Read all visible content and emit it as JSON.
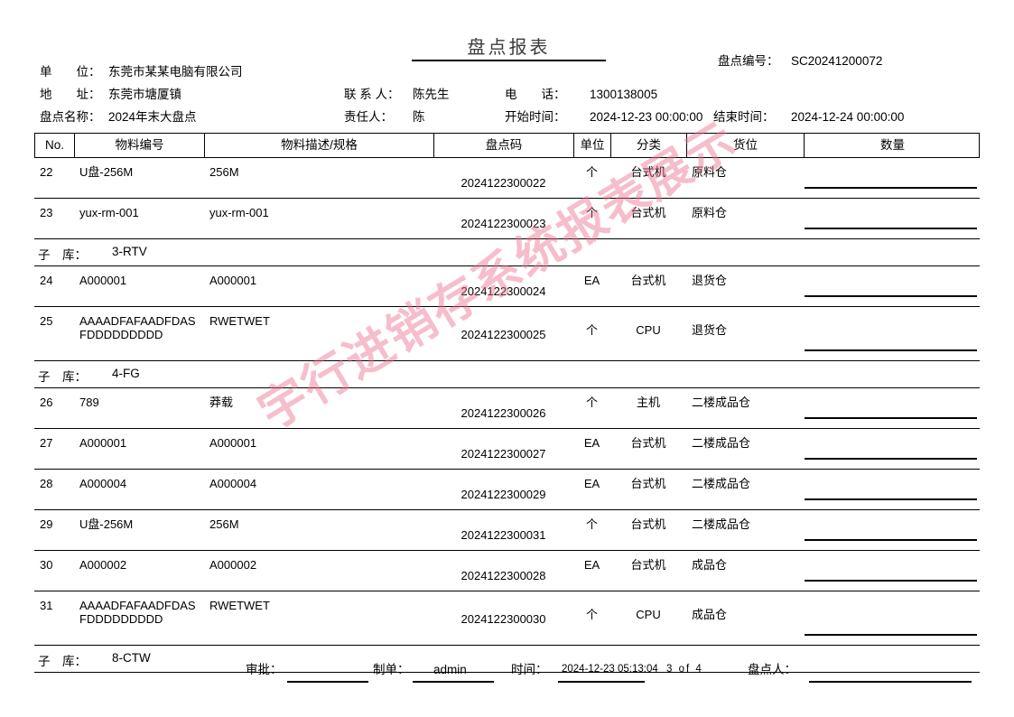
{
  "document": {
    "title": "盘点报表",
    "watermark": "宇行进销存系统报表展示"
  },
  "header": {
    "company_label": "单　　位：",
    "company_value": "东莞市某某电脑有限公司",
    "address_label": "地　　址：",
    "address_value": "东莞市塘厦镇",
    "plan_name_label": "盘点名称：",
    "plan_name_value": "2024年末大盘点",
    "contact_label": "联 系 人：",
    "contact_value": "陈先生",
    "owner_label": "责任人：",
    "owner_value": "陈",
    "phone_label": "电　　话：",
    "phone_value": "1300138005",
    "start_label": "开始时间：",
    "start_value": "2024-12-23 00:00:00",
    "end_label": "结束时间：",
    "end_value": "2024-12-24 00:00:00",
    "doc_no_label": "盘点编号：",
    "doc_no_value": "SC20241200072"
  },
  "table": {
    "columns": [
      {
        "key": "no",
        "label": "No."
      },
      {
        "key": "code",
        "label": "物料编号"
      },
      {
        "key": "desc",
        "label": "物料描述/规格"
      },
      {
        "key": "barcode",
        "label": "盘点码"
      },
      {
        "key": "unit",
        "label": "单位"
      },
      {
        "key": "category",
        "label": "分类"
      },
      {
        "key": "location",
        "label": "货位"
      },
      {
        "key": "qty",
        "label": "数量"
      }
    ],
    "rows": [
      {
        "type": "item",
        "no": "22",
        "code": "U盘-256M",
        "desc": "256M",
        "barcode": "2024122300022",
        "unit": "个",
        "category": "台式机",
        "location": "原料仓",
        "qty": ""
      },
      {
        "type": "item",
        "no": "23",
        "code": "yux-rm-001",
        "desc": "yux-rm-001",
        "barcode": "2024122300023",
        "unit": "个",
        "category": "台式机",
        "location": "原料仓",
        "qty": ""
      },
      {
        "type": "group",
        "label": "子　库：",
        "value": "3-RTV"
      },
      {
        "type": "item",
        "no": "24",
        "code": "A000001",
        "desc": "A000001",
        "barcode": "2024122300024",
        "unit": "EA",
        "category": "台式机",
        "location": "退货仓",
        "qty": ""
      },
      {
        "type": "item",
        "no": "25",
        "code": "AAAADFAFAADFDAS\nFDDDDDDDDD",
        "desc": "RWETWET",
        "barcode": "2024122300025",
        "unit": "个",
        "category": "CPU",
        "location": "退货仓",
        "qty": ""
      },
      {
        "type": "group",
        "label": "子　库：",
        "value": "4-FG"
      },
      {
        "type": "item",
        "no": "26",
        "code": "789",
        "desc": "莽载",
        "barcode": "2024122300026",
        "unit": "个",
        "category": "主机",
        "location": "二楼成品仓",
        "qty": ""
      },
      {
        "type": "item",
        "no": "27",
        "code": "A000001",
        "desc": "A000001",
        "barcode": "2024122300027",
        "unit": "EA",
        "category": "台式机",
        "location": "二楼成品仓",
        "qty": ""
      },
      {
        "type": "item",
        "no": "28",
        "code": "A000004",
        "desc": "A000004",
        "barcode": "2024122300029",
        "unit": "EA",
        "category": "台式机",
        "location": "二楼成品仓",
        "qty": ""
      },
      {
        "type": "item",
        "no": "29",
        "code": "U盘-256M",
        "desc": "256M",
        "barcode": "2024122300031",
        "unit": "个",
        "category": "台式机",
        "location": "二楼成品仓",
        "qty": ""
      },
      {
        "type": "item",
        "no": "30",
        "code": "A000002",
        "desc": "A000002",
        "barcode": "2024122300028",
        "unit": "EA",
        "category": "台式机",
        "location": "成品仓",
        "qty": ""
      },
      {
        "type": "item",
        "no": "31",
        "code": "AAAADFAFAADFDAS\nFDDDDDDDDD",
        "desc": "RWETWET",
        "barcode": "2024122300030",
        "unit": "个",
        "category": "CPU",
        "location": "成品仓",
        "qty": ""
      },
      {
        "type": "group",
        "label": "子　库：",
        "value": "8-CTW"
      }
    ]
  },
  "footer": {
    "approver_label": "审批：",
    "approver_value": "",
    "maker_label": "制单：",
    "maker_value": "admin",
    "time_label": "时间：",
    "time_value": "2024-12-23 05:13:04",
    "page_value": "3 of 4",
    "counter_label": "盘点人：",
    "counter_value": ""
  },
  "colors": {
    "watermark": "#ea6e8c",
    "rule": "#000000",
    "title": "#3b3b3b"
  }
}
